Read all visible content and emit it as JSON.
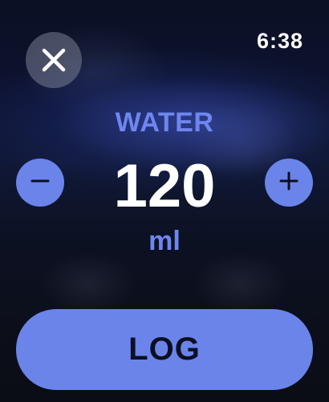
{
  "status_bar": {
    "time": "6:38"
  },
  "close_button": {
    "icon": "close-icon"
  },
  "entry": {
    "label": "WATER",
    "value": "120",
    "unit": "ml"
  },
  "stepper": {
    "decrement_icon": "minus-icon",
    "increment_icon": "plus-icon"
  },
  "action": {
    "log_label": "LOG"
  },
  "colors": {
    "accent": "#6a84ea",
    "accent_text": "#6f86f0",
    "button_text": "#0b0f22"
  }
}
